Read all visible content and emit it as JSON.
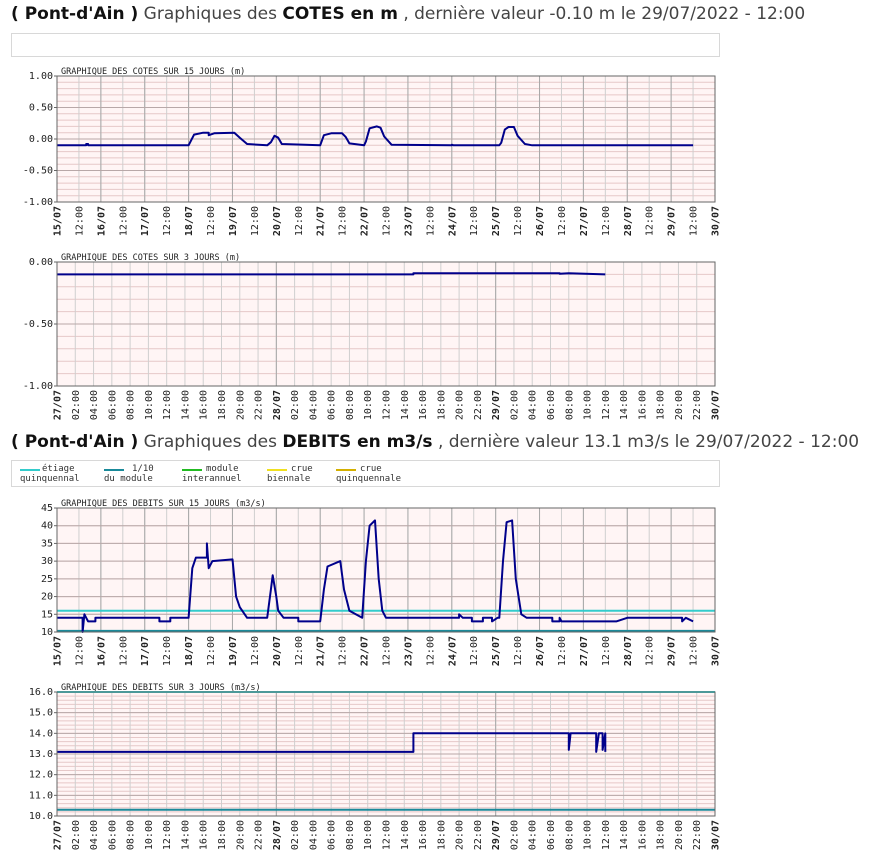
{
  "headings": {
    "cotes": {
      "station": "( Pont-d'Ain )",
      "prefix": "Graphiques des",
      "bold": "COTES en m",
      "suffix": ", dernière valeur -0.10 m le 29/07/2022 - 12:00"
    },
    "debits": {
      "station": "( Pont-d'Ain )",
      "prefix": "Graphiques des",
      "bold": "DEBITS en m3/s",
      "suffix": ", dernière valeur 13.1 m3/s le 29/07/2022 - 12:00"
    }
  },
  "legend": [
    {
      "line1": "étiage",
      "line2": "quinquennal",
      "color": "#33cccc"
    },
    {
      "line1": "1/10",
      "line2": "du module",
      "color": "#1a8a9a"
    },
    {
      "line1": "module",
      "line2": "interannuel",
      "color": "#22bb22"
    },
    {
      "line1": "crue",
      "line2": "biennale",
      "color": "#f0e020"
    },
    {
      "line1": "crue",
      "line2": "quinquennale",
      "color": "#d4b000"
    }
  ],
  "chart_data": [
    {
      "type": "line",
      "title": "GRAPHIQUE DES COTES SUR 15 JOURS (m)",
      "ylim": [
        -1.0,
        1.0
      ],
      "yticks": [
        "1.00",
        "0.50",
        "0.00",
        "-0.50",
        "-1.00"
      ],
      "xlim": [
        0,
        360
      ],
      "xticks": [
        "15/07",
        "12:00",
        "16/07",
        "12:00",
        "17/07",
        "12:00",
        "18/07",
        "12:00",
        "19/07",
        "12:00",
        "20/07",
        "12:00",
        "21/07",
        "12:00",
        "22/07",
        "12:00",
        "23/07",
        "12:00",
        "24/07",
        "12:00",
        "25/07",
        "12:00",
        "26/07",
        "12:00",
        "27/07",
        "12:00",
        "28/07",
        "12:00",
        "29/07",
        "12:00",
        "30/07"
      ],
      "series": [
        {
          "color": "#00008b",
          "points": [
            [
              0,
              -0.1
            ],
            [
              16,
              -0.1
            ],
            [
              16,
              -0.08
            ],
            [
              17,
              -0.08
            ],
            [
              17,
              -0.1
            ],
            [
              72,
              -0.1
            ],
            [
              75,
              0.07
            ],
            [
              80,
              0.1
            ],
            [
              83,
              0.1
            ],
            [
              83,
              0.06
            ],
            [
              86,
              0.09
            ],
            [
              97,
              0.1
            ],
            [
              100,
              0.02
            ],
            [
              104,
              -0.08
            ],
            [
              115,
              -0.1
            ],
            [
              117,
              -0.05
            ],
            [
              119,
              0.05
            ],
            [
              121,
              0.02
            ],
            [
              123,
              -0.08
            ],
            [
              144,
              -0.1
            ],
            [
              146,
              0.06
            ],
            [
              150,
              0.09
            ],
            [
              156,
              0.09
            ],
            [
              158,
              0.03
            ],
            [
              160,
              -0.07
            ],
            [
              168,
              -0.1
            ],
            [
              169,
              -0.04
            ],
            [
              171,
              0.17
            ],
            [
              175,
              0.2
            ],
            [
              177,
              0.18
            ],
            [
              179,
              0.04
            ],
            [
              183,
              -0.09
            ],
            [
              216,
              -0.1
            ],
            [
              216,
              -0.09
            ],
            [
              217,
              -0.1
            ],
            [
              242,
              -0.1
            ],
            [
              243,
              -0.06
            ],
            [
              245,
              0.15
            ],
            [
              247,
              0.19
            ],
            [
              250,
              0.19
            ],
            [
              252,
              0.05
            ],
            [
              256,
              -0.08
            ],
            [
              260,
              -0.1
            ],
            [
              348,
              -0.1
            ]
          ]
        }
      ]
    },
    {
      "type": "line",
      "title": "GRAPHIQUE DES COTES SUR 3 JOURS (m)",
      "ylim": [
        -1.0,
        0.0
      ],
      "yticks": [
        "0.00",
        "-0.50",
        "-1.00"
      ],
      "xlim": [
        0,
        72
      ],
      "xticks": [
        "27/07",
        "02:00",
        "04:00",
        "06:00",
        "08:00",
        "10:00",
        "12:00",
        "14:00",
        "16:00",
        "18:00",
        "20:00",
        "22:00",
        "28/07",
        "02:00",
        "04:00",
        "06:00",
        "08:00",
        "10:00",
        "12:00",
        "14:00",
        "16:00",
        "18:00",
        "20:00",
        "22:00",
        "29/07",
        "02:00",
        "04:00",
        "06:00",
        "08:00",
        "10:00",
        "12:00",
        "14:00",
        "16:00",
        "18:00",
        "20:00",
        "22:00",
        "30/07"
      ],
      "series": [
        {
          "color": "#00008b",
          "points": [
            [
              0,
              -0.1
            ],
            [
              39,
              -0.1
            ],
            [
              39,
              -0.09
            ],
            [
              55,
              -0.09
            ],
            [
              55,
              -0.095
            ],
            [
              56,
              -0.09
            ],
            [
              60,
              -0.1
            ]
          ]
        }
      ]
    },
    {
      "type": "line",
      "title": "GRAPHIQUE DES DEBITS SUR 15 JOURS (m3/s)",
      "ylim": [
        10,
        45
      ],
      "yticks": [
        "45",
        "40",
        "35",
        "30",
        "25",
        "20",
        "15",
        "10"
      ],
      "xlim": [
        0,
        360
      ],
      "xticks": [
        "15/07",
        "12:00",
        "16/07",
        "12:00",
        "17/07",
        "12:00",
        "18/07",
        "12:00",
        "19/07",
        "12:00",
        "20/07",
        "12:00",
        "21/07",
        "12:00",
        "22/07",
        "12:00",
        "23/07",
        "12:00",
        "24/07",
        "12:00",
        "25/07",
        "12:00",
        "26/07",
        "12:00",
        "27/07",
        "12:00",
        "28/07",
        "12:00",
        "29/07",
        "12:00",
        "30/07"
      ],
      "thresholds": [
        {
          "value": 16,
          "color": "#33cccc"
        },
        {
          "value": 10.3,
          "color": "#1a8a9a"
        }
      ],
      "series": [
        {
          "color": "#00008b",
          "points": [
            [
              0,
              14
            ],
            [
              14,
              14
            ],
            [
              14,
              10
            ],
            [
              15,
              15
            ],
            [
              16,
              14
            ],
            [
              17,
              13
            ],
            [
              21,
              13
            ],
            [
              21,
              14
            ],
            [
              56,
              14
            ],
            [
              56,
              13
            ],
            [
              62,
              13
            ],
            [
              62,
              14
            ],
            [
              72,
              14
            ],
            [
              74,
              28
            ],
            [
              76,
              31
            ],
            [
              82,
              31
            ],
            [
              82,
              35
            ],
            [
              83,
              28
            ],
            [
              85,
              30
            ],
            [
              96,
              30.5
            ],
            [
              98,
              20
            ],
            [
              100,
              17
            ],
            [
              104,
              14
            ],
            [
              115,
              14
            ],
            [
              117,
              22
            ],
            [
              118,
              26
            ],
            [
              120,
              20
            ],
            [
              121,
              16
            ],
            [
              124,
              14
            ],
            [
              132,
              14
            ],
            [
              132,
              13
            ],
            [
              144,
              13
            ],
            [
              146,
              22
            ],
            [
              148,
              28.5
            ],
            [
              155,
              30
            ],
            [
              157,
              22
            ],
            [
              160,
              16
            ],
            [
              167,
              14
            ],
            [
              169,
              30
            ],
            [
              171,
              40
            ],
            [
              174,
              41.5
            ],
            [
              176,
              25
            ],
            [
              178,
              16
            ],
            [
              180,
              14
            ],
            [
              220,
              14
            ],
            [
              220,
              15
            ],
            [
              222,
              14
            ],
            [
              227,
              14
            ],
            [
              227,
              13
            ],
            [
              233,
              13
            ],
            [
              233,
              14
            ],
            [
              238,
              14
            ],
            [
              238,
              13
            ],
            [
              241,
              14
            ],
            [
              242,
              14
            ],
            [
              244,
              30
            ],
            [
              246,
              41
            ],
            [
              249,
              41.5
            ],
            [
              251,
              25
            ],
            [
              254,
              15
            ],
            [
              257,
              14
            ],
            [
              271,
              14
            ],
            [
              271,
              13
            ],
            [
              275,
              13
            ],
            [
              275,
              14
            ],
            [
              276,
              13
            ],
            [
              306,
              13
            ],
            [
              312,
              14
            ],
            [
              330,
              14
            ],
            [
              342,
              14
            ],
            [
              342,
              13
            ],
            [
              344,
              14
            ],
            [
              348,
              13
            ]
          ]
        }
      ]
    },
    {
      "type": "line",
      "title": "GRAPHIQUE DES DEBITS SUR 3 JOURS (m3/s)",
      "ylim": [
        10.0,
        16.0
      ],
      "yticks": [
        "16.0",
        "15.0",
        "14.0",
        "13.0",
        "12.0",
        "11.0",
        "10.0"
      ],
      "xlim": [
        0,
        72
      ],
      "xticks": [
        "27/07",
        "02:00",
        "04:00",
        "06:00",
        "08:00",
        "10:00",
        "12:00",
        "14:00",
        "16:00",
        "18:00",
        "20:00",
        "22:00",
        "28/07",
        "02:00",
        "04:00",
        "06:00",
        "08:00",
        "10:00",
        "12:00",
        "14:00",
        "16:00",
        "18:00",
        "20:00",
        "22:00",
        "29/07",
        "02:00",
        "04:00",
        "06:00",
        "08:00",
        "10:00",
        "12:00",
        "14:00",
        "16:00",
        "18:00",
        "20:00",
        "22:00",
        "30/07"
      ],
      "thresholds": [
        {
          "value": 16.0,
          "color": "#33cccc"
        },
        {
          "value": 10.3,
          "color": "#1a8a9a"
        }
      ],
      "series": [
        {
          "color": "#00008b",
          "points": [
            [
              0,
              13.1
            ],
            [
              39,
              13.1
            ],
            [
              39,
              14.0
            ],
            [
              56,
              14.0
            ],
            [
              56,
              13.2
            ],
            [
              56.2,
              14.0
            ],
            [
              59,
              14.0
            ],
            [
              59,
              13.1
            ],
            [
              59.3,
              14.0
            ],
            [
              59.7,
              14.0
            ],
            [
              59.7,
              13.2
            ],
            [
              60,
              14.0
            ],
            [
              60,
              13.1
            ]
          ]
        }
      ]
    }
  ]
}
